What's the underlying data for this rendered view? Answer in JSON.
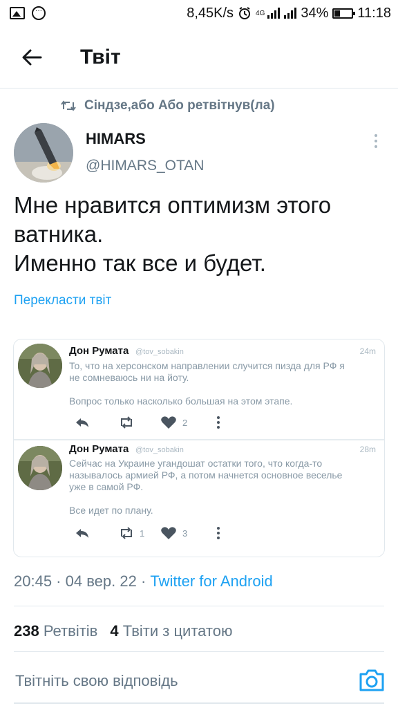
{
  "status_bar": {
    "speed": "8,45K/s",
    "network": "4G",
    "battery_percent": "34%",
    "battery_level": 0.34,
    "time": "11:18"
  },
  "header": {
    "title": "Твіт"
  },
  "retweet": {
    "label": "Сіндзе,або Або ретвітнув(ла)"
  },
  "author": {
    "name": "HIMARS",
    "handle": "@HIMARS_OTAN"
  },
  "tweet": {
    "lines": [
      "Мне нравится оптимизм этого",
      "ватника.",
      "Именно так все и будет."
    ],
    "translate_label": "Перекласти твіт"
  },
  "embedded": {
    "tweets": [
      {
        "name": "Дон Румата",
        "handle": "@tov_sobakin",
        "time": "24m",
        "text_lines": [
          "То, что на херсонском направлении случится пизда для РФ я",
          "не сомневаюсь ни на йоту.",
          "",
          "Вопрос только насколько большая на этом этапе."
        ],
        "retweets": "",
        "likes": "2"
      },
      {
        "name": "Дон Румата",
        "handle": "@tov_sobakin",
        "time": "28m",
        "text_lines": [
          "Сейчас на Украине угандошат остатки того, что когда-то",
          "называлось армией РФ, а потом начнется основное веселье",
          "уже в самой РФ.",
          "",
          "Все идет по плану."
        ],
        "retweets": "1",
        "likes": "3"
      }
    ]
  },
  "meta": {
    "time": "20:45",
    "date": "04 вер. 22",
    "separator": " · ",
    "source": "Twitter for Android"
  },
  "stats": {
    "retweets_count": "238",
    "retweets_label": "Ретвітів",
    "quotes_count": "4",
    "quotes_label": "Твіти з цитатою"
  },
  "reply": {
    "placeholder": "Твітніть свою відповідь"
  },
  "colors": {
    "accent": "#1da1f2",
    "secondary_text": "#657786",
    "primary_text": "#14171a",
    "border": "#e1e8ed"
  }
}
